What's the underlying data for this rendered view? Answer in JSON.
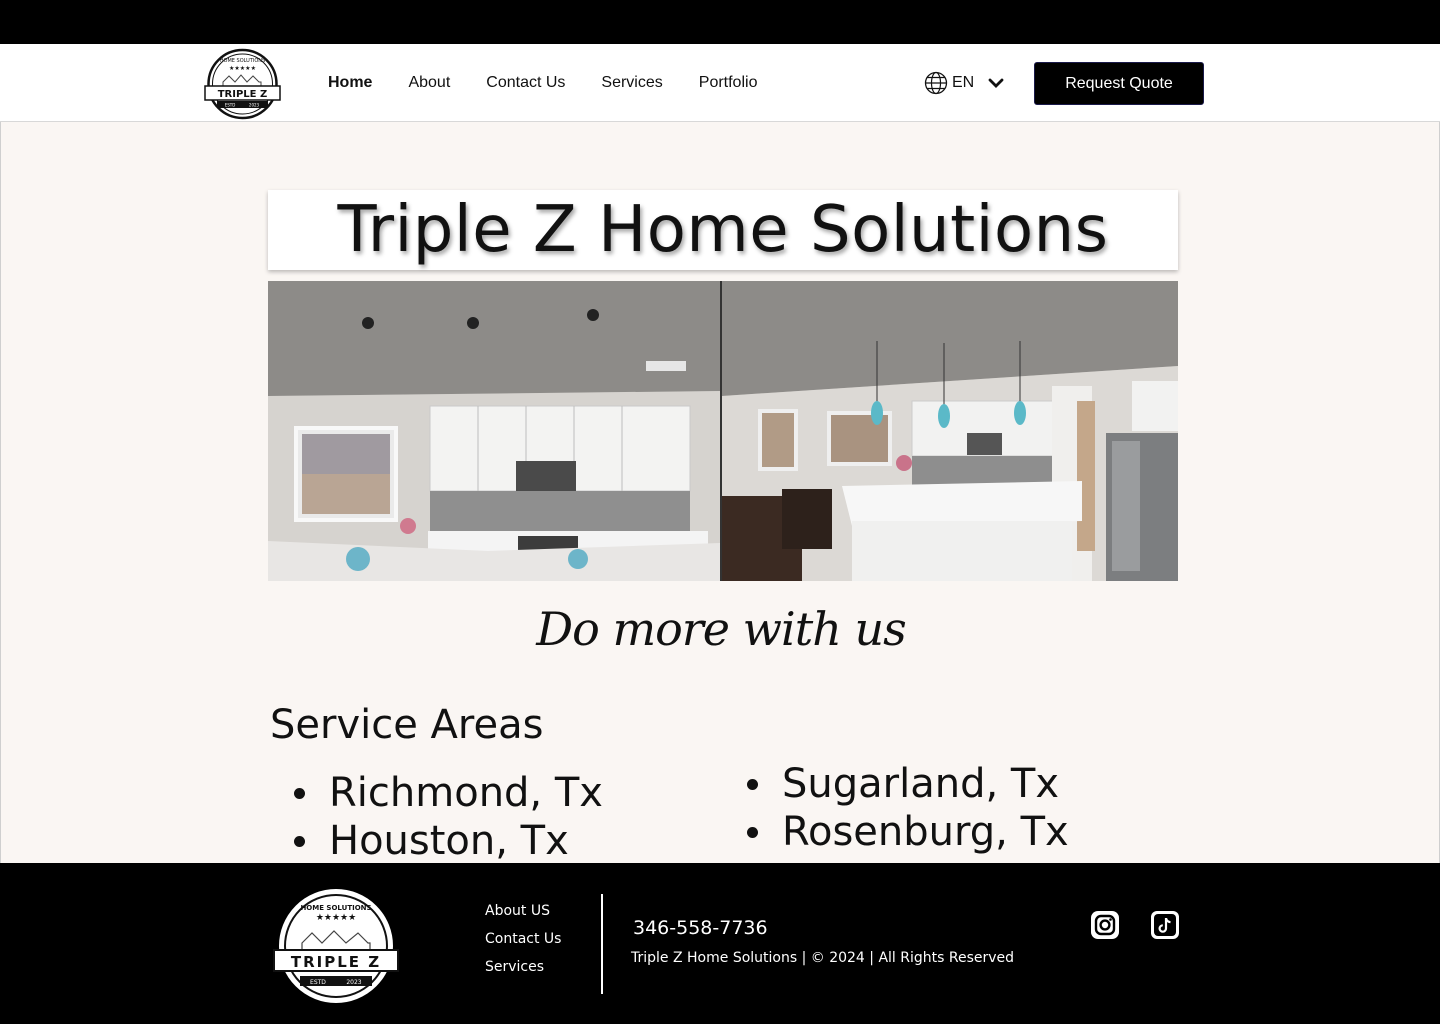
{
  "header": {
    "logo_alt": "Triple Z Home Solutions logo",
    "nav": [
      {
        "label": "Home",
        "active": true
      },
      {
        "label": "About",
        "active": false
      },
      {
        "label": "Contact Us",
        "active": false
      },
      {
        "label": "Services",
        "active": false
      },
      {
        "label": "Portfolio",
        "active": false
      }
    ],
    "language": "EN",
    "quote_button": "Request Quote"
  },
  "logo": {
    "arc_text": "HOME SOLUTIONS",
    "name": "TRIPLE Z",
    "estd": "ESTD",
    "year": "2023"
  },
  "hero": {
    "title": "Triple Z Home Solutions",
    "photos": [
      {
        "icon": "kitchen-photo",
        "description": "kitchen-left"
      },
      {
        "icon": "kitchen-photo",
        "description": "kitchen-right"
      }
    ]
  },
  "tagline": "Do more with us",
  "service_areas": {
    "title": "Service Areas",
    "left": [
      "Richmond, Tx",
      "Houston, Tx"
    ],
    "right": [
      "Sugarland, Tx",
      "Rosenburg, Tx"
    ]
  },
  "footer": {
    "links": [
      "About US",
      "Contact Us",
      "Services"
    ],
    "phone": "346-558-7736",
    "copyright": "Triple Z Home Solutions | © 2024 | All Rights Reserved",
    "social": [
      "instagram-icon",
      "tiktok-icon"
    ]
  },
  "colors": {
    "background": "#faf6f3",
    "header_bg": "#ffffff",
    "footer_bg": "#000000",
    "button_bg": "#000000"
  }
}
